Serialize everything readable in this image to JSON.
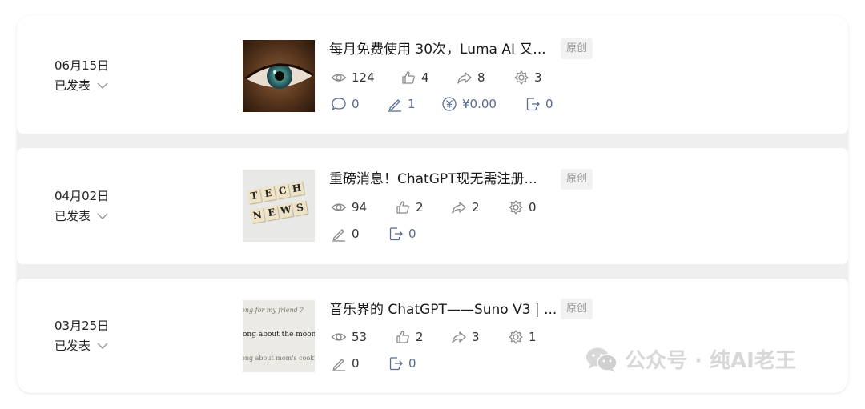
{
  "posts": [
    {
      "date": "06月15日",
      "status": "已发表",
      "title": "每月免费使用 30次，Luma AI 又...",
      "tag": "原创",
      "views": "124",
      "likes": "4",
      "shares": "8",
      "recommends": "3",
      "comments": "0",
      "notes": "1",
      "rewards": "¥0.00",
      "forwards": "0"
    },
    {
      "date": "04月02日",
      "status": "已发表",
      "title": "重磅消息！ChatGPT现无需注册...",
      "tag": "原创",
      "views": "94",
      "likes": "2",
      "shares": "2",
      "recommends": "0",
      "notes": "0",
      "forwards": "0",
      "thumb_tiles_1": [
        "T",
        "E",
        "C",
        "H"
      ],
      "thumb_tiles_2": [
        "N",
        "E",
        "W",
        "S"
      ]
    },
    {
      "date": "03月25日",
      "status": "已发表",
      "title": "音乐界的 ChatGPT——Suno V3 | ...",
      "tag": "原创",
      "views": "53",
      "likes": "2",
      "shares": "3",
      "recommends": "1",
      "notes": "0",
      "forwards": "0",
      "thumb_lines": [
        "ong for my friend ?",
        "ong about the moon.",
        "ong about mom's cookin"
      ]
    }
  ],
  "watermark": "公众号 · 纯AI老王",
  "colors": {
    "link_blue": "#576b95",
    "text": "#222222",
    "tag_bg": "#f2f2f2"
  }
}
